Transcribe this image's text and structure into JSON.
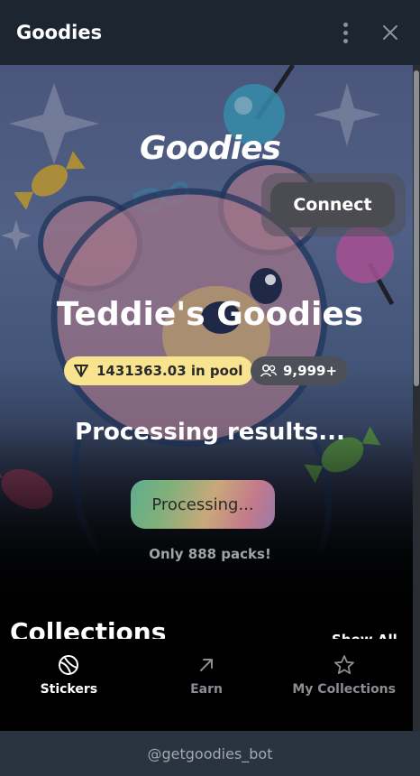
{
  "window": {
    "title": "Goodies"
  },
  "hero": {
    "logo": "Goodies",
    "connect_label": "Connect",
    "heading": "Teddie's Goodies",
    "pool_text": "1431363.03 in pool",
    "users_text": "9,999+",
    "status_text": "Processing results...",
    "processing_label": "Processing...",
    "packs_text": "Only 888 packs!"
  },
  "collections": {
    "title": "Collections",
    "show_all": "Show All"
  },
  "tabs": [
    {
      "label": "Stickers",
      "icon": "sticker-icon",
      "active": true
    },
    {
      "label": "Earn",
      "icon": "arrow-up-right-icon",
      "active": false
    },
    {
      "label": "My Collections",
      "icon": "star-icon",
      "active": false
    }
  ],
  "footer": {
    "bot": "@getgoodies_bot"
  },
  "colors": {
    "titlebar": "#1c2530",
    "pool_badge": "#f8e38e",
    "users_badge": "#4d5058",
    "footer": "#2a3440"
  }
}
